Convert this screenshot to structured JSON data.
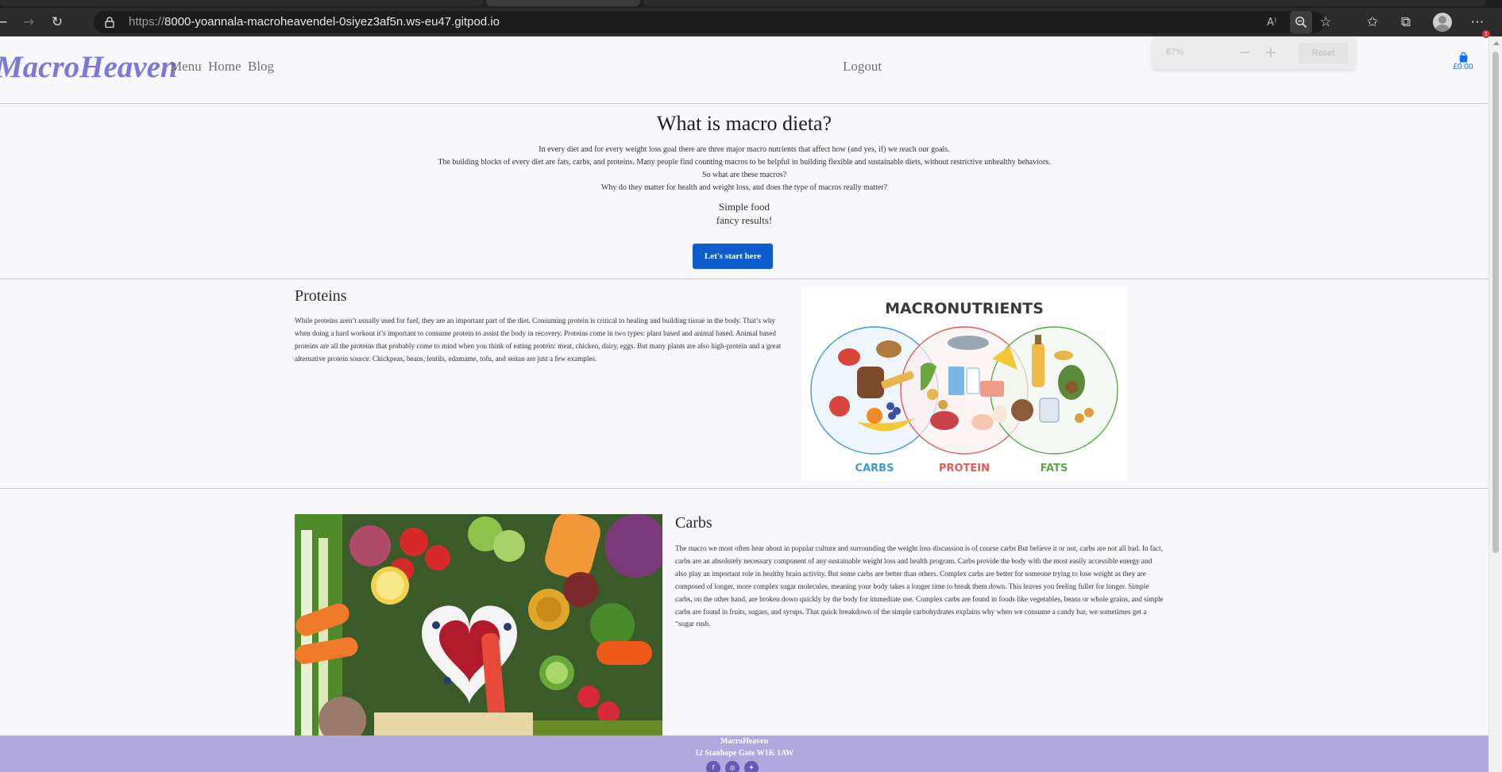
{
  "browser": {
    "url_scheme": "https://",
    "url_rest": "8000-yoannala-macroheavendel-0siyez3af5n.ws-eu47.gitpod.io",
    "zoom_level": "67%",
    "zoom_reset_label": "Reset",
    "notification_count": "1",
    "icons": [
      "back-icon",
      "forward-icon",
      "refresh-icon",
      "lock-icon",
      "read-aloud-icon",
      "zoom-icon",
      "favorite-add-icon",
      "favorites-icon",
      "collections-icon",
      "profile-icon",
      "more-icon"
    ]
  },
  "nav": {
    "brand": "MacroHeaven",
    "menu": "Menu",
    "home": "Home",
    "blog": "Blog",
    "logout": "Logout",
    "cart_total": "£0.00"
  },
  "hero": {
    "title": "What is macro dieta?",
    "intro_lines": [
      "In every diet and for every weight loss goal there are three major macro nutrients that affect how (and yes, if) we reach our goals.",
      "The building blocks of every diet are fats, carbs, and proteins. Many people find counting macros to be helpful in building flexible and sustainable diets, without restrictive unhealthy behaviors.",
      "So what are these macros?",
      "Why do they matter for health and weight loss, and does the type of macros really matter?"
    ],
    "tagline_1": "Simple food",
    "tagline_2": "fancy results!",
    "cta": "Let's start here"
  },
  "proteins": {
    "title": "Proteins",
    "body": "While proteins aren’t usually used for fuel, they are an important part of the diet. Consuming protein is critical to healing and building tissue in the body. That’s why when doing a hard workout it’s important to consume protein to assist the body in recovery. Proteins come in two types: plant based and animal based. Animal based proteins are all the proteins that probably come to mind when you think of eating protein: meat, chicken, dairy, eggs. But many plants are also high-protein and a great alternative protein source. Chickpeas, beans, lentils, edamame, tofu, and seitan are just a few examples."
  },
  "macro_image": {
    "heading": "MACRONUTRIENTS",
    "labels": [
      "CARBS",
      "PROTEIN",
      "FATS"
    ],
    "colors": [
      "#3a9ad9",
      "#e05a5a",
      "#5aa84a"
    ]
  },
  "carbs": {
    "title": "Carbs",
    "body": "The macro we most often hear about in popular culture and surrounding the weight loss discussion is of course carbs But believe it or not, carbs are not all bad. In fact, carbs are an absolutely necessary component of any sustainable weight loss and health program. Carbs provide the body with the most easily accessible energy and also play an important role in healthy brain activity. But some carbs are better than others. Complex carbs are better for someone trying to lose weight as they are composed of longer, more complex sugar molecules, meaning your body takes a longer time to break them down. This leaves you feeling fuller for longer. Simple carbs, on the other hand, are broken down quickly by the body for immediate use. Complex carbs are found in foods like vegetables, beans or whole grains, and simple carbs are found in fruits, sugars, and syrups. That quick breakdown of the simple carbohydrates explains why when we consume a candy bar, we sometimes get a “sugar rush."
  },
  "footer": {
    "name": "MacroHeaven",
    "address": "12 Stanhope Gate W1K 1AW",
    "social": [
      "facebook-icon",
      "instagram-icon",
      "twitter-icon"
    ]
  },
  "colors": {
    "brand": "#7a78d8",
    "button": "#0d5dcf",
    "footer": "#b0a8df",
    "cart": "#0d6efd"
  }
}
